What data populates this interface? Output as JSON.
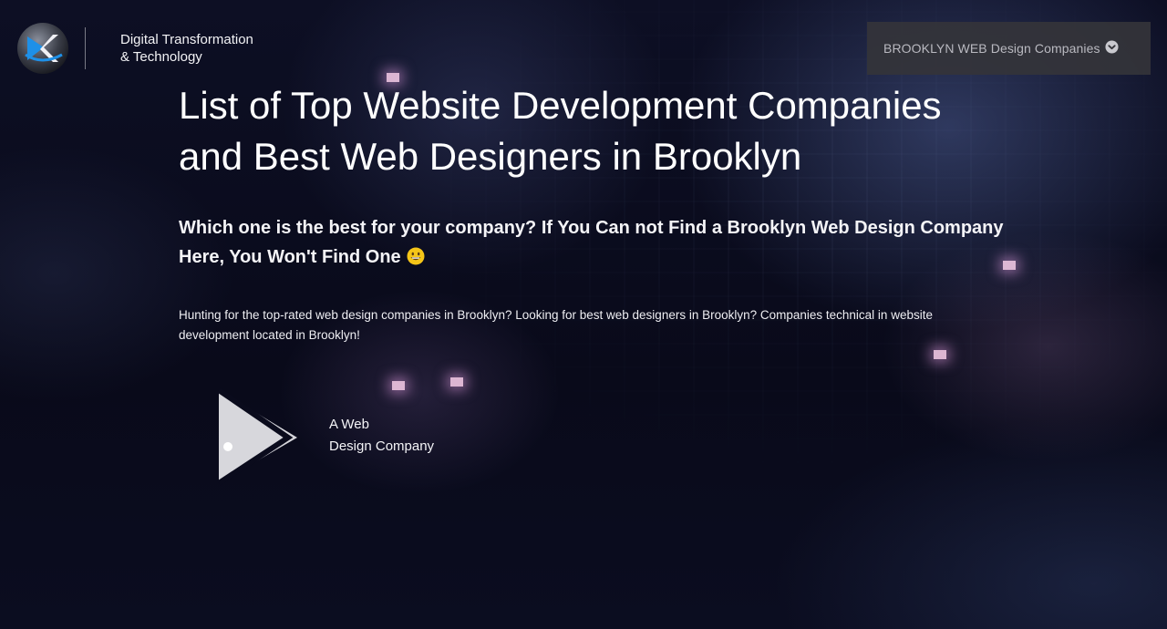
{
  "brand": {
    "tagline_line1": "Digital Transformation",
    "tagline_line2": "& Technology"
  },
  "nav": {
    "dropdown_label": "BROOKLYN WEB Design Companies",
    "dropdown_icon": "chevron-down-circle-icon"
  },
  "hero": {
    "headline_line1": "List of Top Website Development Companies",
    "headline_line2": "and Best Web Designers in Brooklyn",
    "subheadline_line1": "Which one is the best for your company? If You Can not Find a Brooklyn Web Design Company",
    "subheadline_line2": "Here, You Won't Find One",
    "subheadline_emoji": "grinning-face-emoji",
    "body_line1": "Hunting for the top-rated web design companies in Brooklyn? Looking for best web designers in Brooklyn? Companies technical in website",
    "body_line2": "development located in Brooklyn!"
  },
  "companies": [
    {
      "name_line1": "A Web",
      "name_line2": "Design Company",
      "logo_icon": "play-triangle-logo-icon"
    }
  ],
  "colors": {
    "background": "#0a0b1c",
    "text": "#ffffff",
    "dropdown_bg": "#343438",
    "dropdown_text": "#b9b9c0",
    "emoji_yellow": "#f5c518"
  }
}
